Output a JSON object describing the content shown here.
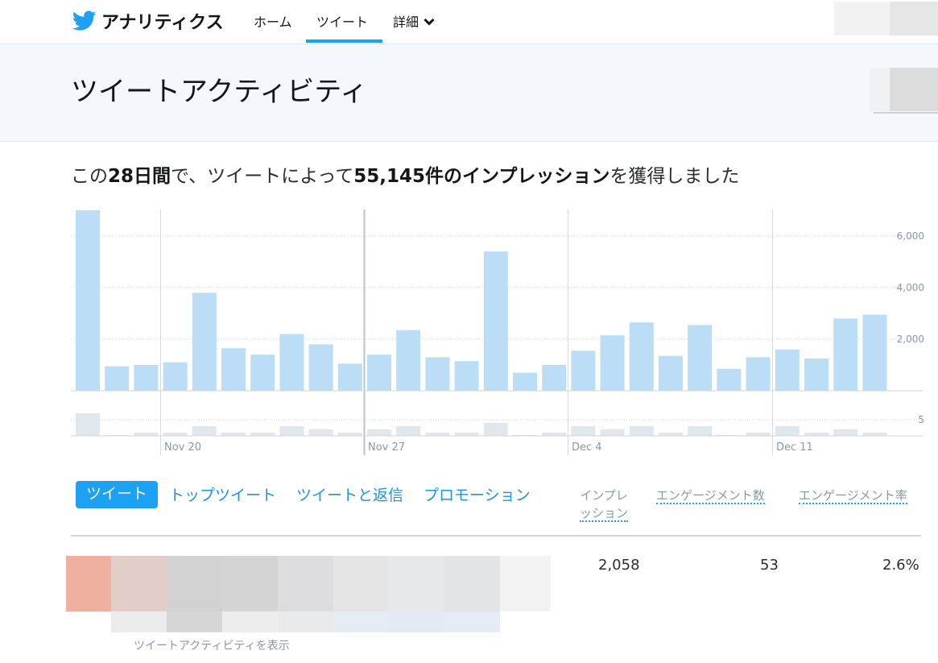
{
  "header": {
    "brand": "アナリティクス",
    "nav": {
      "home": "ホーム",
      "tweets": "ツイート",
      "more": "詳細"
    }
  },
  "page_title": "ツイートアクティビティ",
  "summary": {
    "prefix": "この",
    "period": "28日間",
    "middle": "で、ツイートによって",
    "impressions": "55,145件のインプレッション",
    "suffix": "を獲得しました"
  },
  "chart_data": {
    "type": "bar",
    "series": [
      {
        "name": "インプレッション",
        "values": [
          7000,
          950,
          1000,
          1100,
          3800,
          1650,
          1400,
          2200,
          1800,
          1050,
          1400,
          2350,
          1300,
          1150,
          5400,
          700,
          1000,
          1550,
          2150,
          2650,
          1350,
          2550,
          850,
          1300,
          1600,
          1250,
          2800,
          2950
        ]
      },
      {
        "name": "エンゲージメント",
        "values": [
          7,
          0,
          1,
          1,
          3,
          1,
          1,
          3,
          2,
          1,
          2,
          3,
          1,
          1,
          4,
          0,
          1,
          3,
          2,
          3,
          1,
          3,
          0,
          1,
          3,
          1,
          2,
          1
        ]
      }
    ],
    "x_ticks": [
      "Nov 20",
      "Nov 27",
      "Dec 4",
      "Dec 11"
    ],
    "y_ticks_impressions": [
      "2,000",
      "4,000",
      "6,000"
    ],
    "y_ticks_engagements": [
      "5"
    ],
    "colors": {
      "impressions": "#bbddf5",
      "engagements": "#e1e8ed"
    }
  },
  "tabs": {
    "tweets": "ツイート",
    "top": "トップツイート",
    "replies": "ツイートと返信",
    "promo": "プロモーション"
  },
  "columns": {
    "impressions_l1": "インプレ",
    "impressions_l2": "ッション",
    "engagements": "エンゲージメント数",
    "rate": "エンゲージメント率"
  },
  "row": {
    "impressions": "2,058",
    "engagements": "53",
    "rate": "2.6%",
    "view_activity": "ツイートアクティビティを表示"
  }
}
